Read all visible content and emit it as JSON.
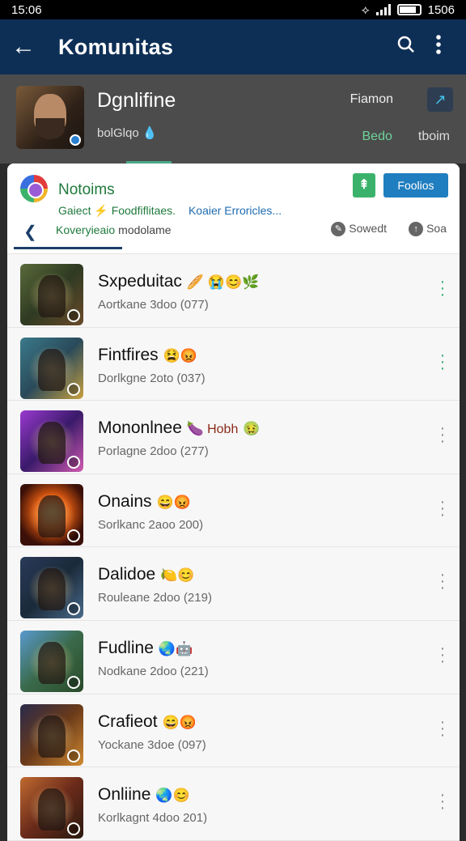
{
  "status": {
    "time": "15:06",
    "right_time": "1506"
  },
  "appbar": {
    "title": "Komunitas",
    "back_icon": "arrow-left-icon",
    "search_icon": "search-icon",
    "more_icon": "more-vert-icon"
  },
  "profile": {
    "name": "Dgnlifine",
    "subtitle": "bolGlqo",
    "right_label": "Fiamon",
    "green_label": "Bedo",
    "white_label": "tboim",
    "share_icon": "share-icon"
  },
  "community": {
    "title": "Notoims",
    "sub_part1": "Gaiect",
    "sub_part1b": "Foodfiflitaes.",
    "sub_part2": "Koaier Erroricles...",
    "follow_label": "Foolios",
    "tabs": {
      "active_green": "Koveryieaio",
      "active_dark": "modolame",
      "search": "Sowedt",
      "sort": "Soa"
    }
  },
  "items": [
    {
      "title": "Sxpeduitac",
      "emojis": "🥖 😭😊🌿",
      "emoji_text": "",
      "subtitle": "Aortkane 3doo (077)",
      "menu_color": "green",
      "thumb_bg": "linear-gradient(135deg,#5a6b3a,#2e3a22 50%,#6a4a2a)"
    },
    {
      "title": "Fintfires",
      "emojis": "😫😡",
      "emoji_text": "",
      "subtitle": "Dorlkgne 2oto (037)",
      "menu_color": "green",
      "thumb_bg": "linear-gradient(135deg,#3a7a8a,#2a4a5a 50%,#c8a040)"
    },
    {
      "title": "Mononlnee",
      "emojis": "🍆",
      "emoji_text": "Hobh",
      "emojis_after": "🤢",
      "subtitle": "Porlagne 2doo (277)",
      "menu_color": "gray",
      "thumb_bg": "linear-gradient(135deg,#9a3ad0,#3a1a6a 50%,#d05ab0)"
    },
    {
      "title": "Onains",
      "emojis": "😄😡",
      "emoji_text": "",
      "subtitle": "Sorlkanc 2aoo 200)",
      "menu_color": "gray",
      "thumb_bg": "radial-gradient(circle at 50% 45%,#ffd080,#e05a10 35%,#3a1008 75%)"
    },
    {
      "title": "Dalidoe",
      "emojis": "🍋😊",
      "emoji_text": "",
      "subtitle": "Rouleane 2doo (219)",
      "menu_color": "gray",
      "thumb_bg": "linear-gradient(135deg,#2a3a5a,#1a2a3a 50%,#4a6a8a)"
    },
    {
      "title": "Fudline",
      "emojis": "🌏🤖",
      "emoji_text": "",
      "subtitle": "Nodkane 2doo (221)",
      "menu_color": "gray",
      "thumb_bg": "linear-gradient(135deg,#5a9ad0,#3a6a4a 50%,#2a4a2a)"
    },
    {
      "title": "Crafieot",
      "emojis": "😄😡",
      "emoji_text": "",
      "subtitle": "Yockane 3doe (097)",
      "menu_color": "gray",
      "thumb_bg": "linear-gradient(135deg,#2a2a4a,#6a3a1a 50%,#d08a30)"
    },
    {
      "title": "Onliine",
      "emojis": "🌏😊",
      "emoji_text": "",
      "subtitle": "Korlkagnt 4doo 201)",
      "menu_color": "gray",
      "thumb_bg": "linear-gradient(135deg,#c06a30,#6a2a1a 50%,#2a1a10)"
    }
  ]
}
